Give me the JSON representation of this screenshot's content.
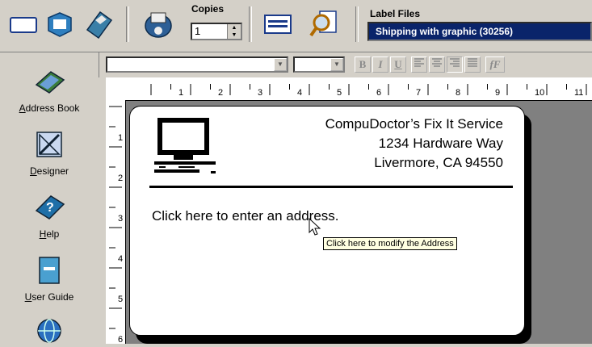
{
  "toolbar": {
    "copies_label": "Copies",
    "copies_value": "1",
    "label_files_label": "Label Files",
    "label_files_value": "Shipping with graphic (30256)"
  },
  "sidebar": {
    "items": [
      {
        "label": "Address Book",
        "mnemonic": "A",
        "rest": "ddress Book",
        "icon": "address-book-icon"
      },
      {
        "label": "Designer",
        "mnemonic": "D",
        "rest": "esigner",
        "icon": "designer-icon"
      },
      {
        "label": "Help",
        "mnemonic": "H",
        "rest": "elp",
        "icon": "help-icon"
      },
      {
        "label": "User Guide",
        "mnemonic": "U",
        "rest": "ser Guide",
        "icon": "user-guide-icon"
      },
      {
        "label": "",
        "icon": "globe-icon"
      }
    ]
  },
  "format_bar": {
    "bold": "B",
    "italic": "I",
    "underline": "U",
    "font_fx": "fF"
  },
  "ruler": {
    "h_numbers": [
      "1",
      "2",
      "3",
      "4",
      "5",
      "6",
      "7",
      "8",
      "9",
      "10",
      "11"
    ],
    "v_numbers": [
      "1",
      "2",
      "3",
      "4",
      "5",
      "6"
    ]
  },
  "label": {
    "company": "CompuDoctor’s Fix It Service",
    "street": "1234 Hardware Way",
    "city": "Livermore, CA 94550",
    "address_prompt": "Click here to enter an address."
  },
  "tooltip": "Click here to modify the Address"
}
